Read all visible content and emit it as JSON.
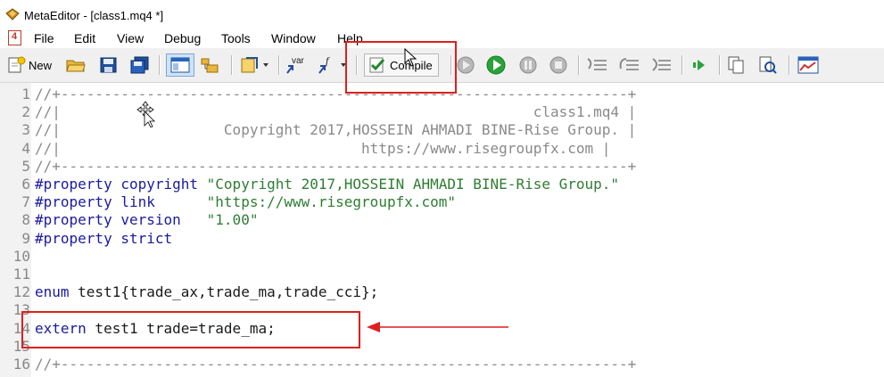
{
  "window": {
    "title": "MetaEditor - [class1.mq4 *]"
  },
  "menu": {
    "items": [
      "File",
      "Edit",
      "View",
      "Debug",
      "Tools",
      "Window",
      "Help"
    ]
  },
  "toolbar": {
    "new_label": "New",
    "compile_label": "Compile"
  },
  "editor": {
    "lines": [
      {
        "num": "1",
        "text": "//+------------------------------------------------------------------+",
        "kind": "comment"
      },
      {
        "num": "2",
        "text": "//|                                                       class1.mq4 |",
        "kind": "comment"
      },
      {
        "num": "3",
        "text": "//|                   Copyright 2017,HOSSEIN AHMADI BINE-Rise Group. |",
        "kind": "comment"
      },
      {
        "num": "4",
        "text": "//|                                   https://www.risegroupfx.com |",
        "kind": "comment"
      },
      {
        "num": "5",
        "text": "//+------------------------------------------------------------------+",
        "kind": "comment"
      },
      {
        "num": "6",
        "pp": "#property copyright ",
        "str": "\"Copyright 2017,HOSSEIN AHMADI BINE-Rise Group.\"",
        "kind": "prop"
      },
      {
        "num": "7",
        "pp": "#property link      ",
        "str": "\"https://www.risegroupfx.com\"",
        "kind": "prop"
      },
      {
        "num": "8",
        "pp": "#property version   ",
        "str": "\"1.00\"",
        "kind": "prop"
      },
      {
        "num": "9",
        "pp": "#property strict",
        "str": "",
        "kind": "prop"
      },
      {
        "num": "10",
        "text": "",
        "kind": "plain"
      },
      {
        "num": "11",
        "text": "",
        "kind": "plain"
      },
      {
        "num": "12",
        "kw": "enum",
        "rest": " test1{trade_ax,trade_ma,trade_cci};",
        "kind": "kw"
      },
      {
        "num": "13",
        "text": "",
        "kind": "plain"
      },
      {
        "num": "14",
        "kw": "extern",
        "rest": " test1 trade=trade_ma;",
        "kind": "kw"
      },
      {
        "num": "15",
        "text": "",
        "kind": "plain"
      },
      {
        "num": "16",
        "text": "//+------------------------------------------------------------------+",
        "kind": "comment"
      }
    ]
  },
  "colors": {
    "annotation": "#e01e1e",
    "comment": "#8a8a8a",
    "preprocessor": "#1a1aa0",
    "string": "#2f7d32"
  }
}
